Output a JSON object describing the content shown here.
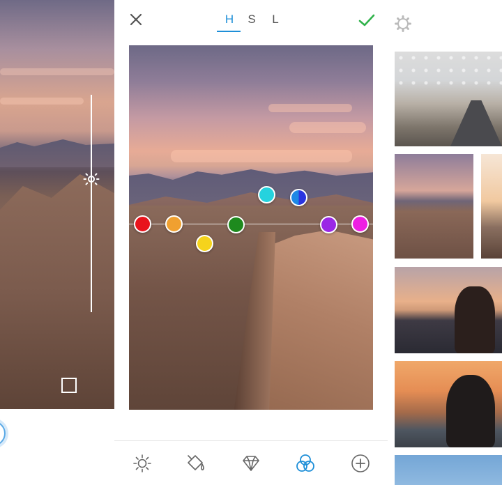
{
  "header": {
    "tabs": [
      {
        "label": "H",
        "active": true
      },
      {
        "label": "S",
        "active": false
      },
      {
        "label": "L",
        "active": false
      }
    ],
    "close_icon": "close-icon",
    "confirm_icon": "checkmark-icon",
    "settings_icon": "gear-icon"
  },
  "colors": {
    "accent": "#1e8fd8",
    "confirm": "#2fb24a"
  },
  "hue_dots": [
    {
      "name": "red",
      "color": "#e8141c"
    },
    {
      "name": "orange",
      "color": "#f0a030"
    },
    {
      "name": "yellow",
      "color": "#f5d31c"
    },
    {
      "name": "green",
      "color": "#1e8a1e"
    },
    {
      "name": "aqua",
      "color": "#25d2de"
    },
    {
      "name": "blue",
      "color": "#2a35e0"
    },
    {
      "name": "purple",
      "color": "#9a28e6"
    },
    {
      "name": "magenta",
      "color": "#ee1ee2"
    }
  ],
  "toolbar": {
    "tools": [
      {
        "icon": "brightness-icon",
        "active": false
      },
      {
        "icon": "paint-bucket-icon",
        "active": false
      },
      {
        "icon": "diamond-icon",
        "active": false
      },
      {
        "icon": "color-circles-icon",
        "active": true
      },
      {
        "icon": "add-icon",
        "active": false
      }
    ]
  },
  "left_panel": {
    "slider_icon": "brightness-icon",
    "square_icon": "square-icon"
  }
}
